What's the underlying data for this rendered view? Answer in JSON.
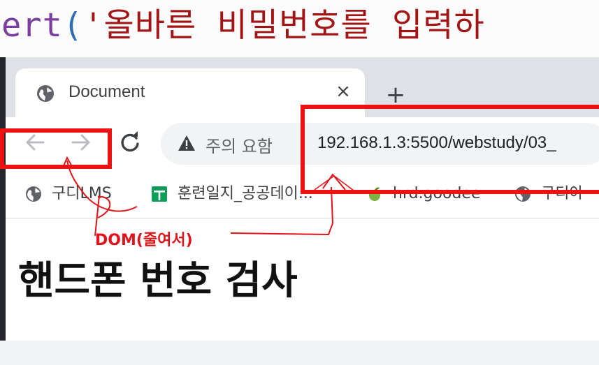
{
  "code": {
    "fn_fragment": "ert",
    "paren": "(",
    "string_fragment": "'올바른 비밀번호를 입력하"
  },
  "browser": {
    "tab": {
      "title": "Document",
      "close_glyph": "×",
      "icon": "globe-icon"
    },
    "new_tab_glyph": "+",
    "toolbar": {
      "back_icon": "arrow-left-icon",
      "forward_icon": "arrow-right-icon",
      "reload_icon": "reload-icon",
      "security_label": "주의 요함",
      "url": "192.168.1.3:5500/webstudy/03_"
    },
    "bookmarks": [
      {
        "label": "구디LMS",
        "icon": "globe-icon"
      },
      {
        "label": "훈련일지_공공데이...",
        "icon": "sheets-icon"
      },
      {
        "label": "hrd.goodee",
        "icon": "leaf-icon"
      },
      {
        "label": "구디아",
        "icon": "globe-icon"
      }
    ],
    "page": {
      "heading": "핸드폰 번호 검사"
    }
  },
  "annotation": {
    "label": "DOM(줄여서)",
    "color": "#ee1111"
  },
  "colors": {
    "tab_strip": "#dee1e6",
    "omnibox": "#f1f3f4",
    "annotation": "#ee1111"
  }
}
